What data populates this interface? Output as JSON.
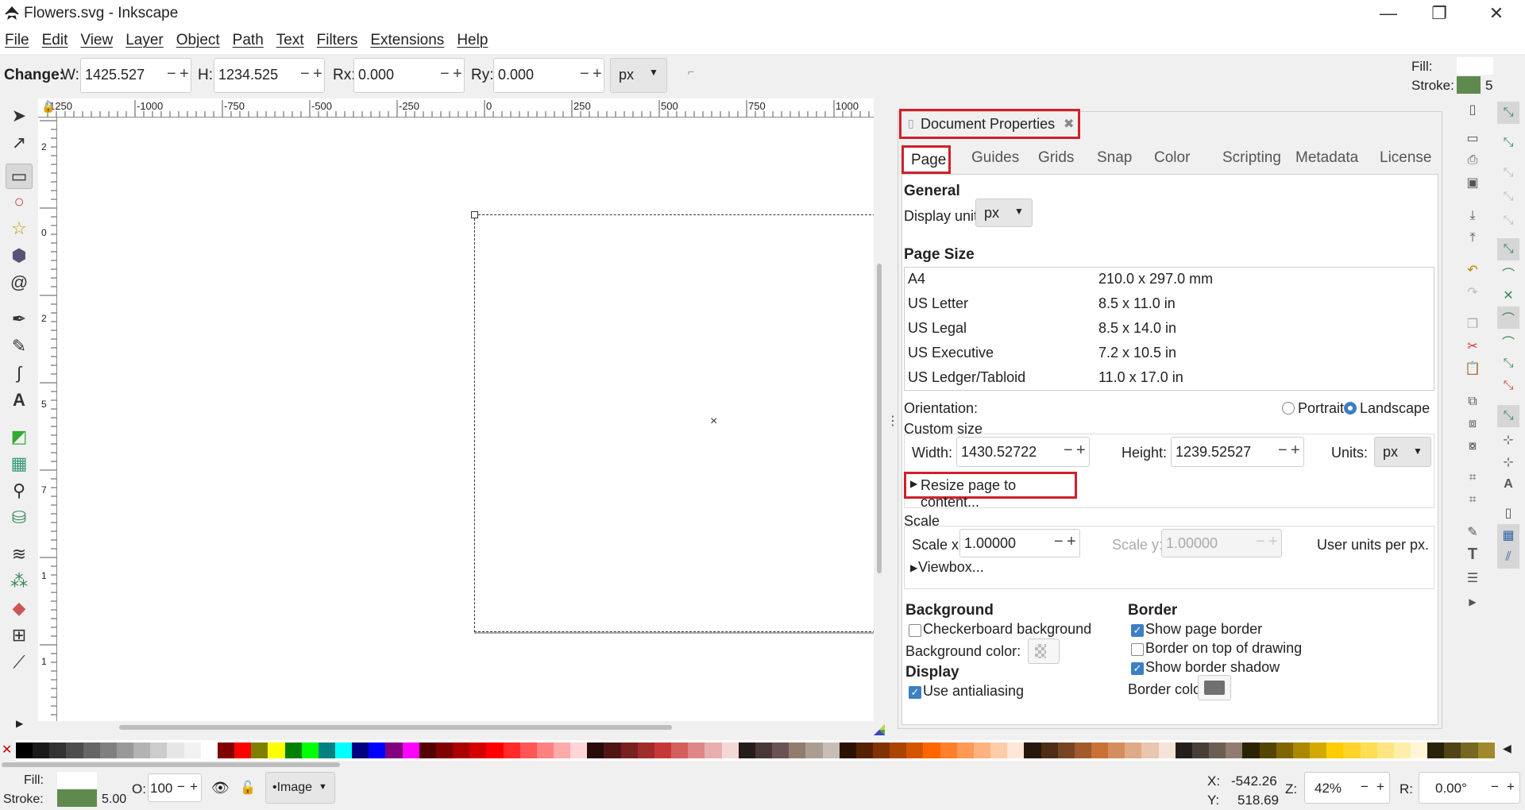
{
  "window": {
    "title": "Flowers.svg - Inkscape",
    "minimize": "—",
    "restore": "❐",
    "close": "✕"
  },
  "menu": [
    "File",
    "Edit",
    "View",
    "Layer",
    "Object",
    "Path",
    "Text",
    "Filters",
    "Extensions",
    "Help"
  ],
  "toolcontrols": {
    "change_label": "Change:",
    "w_label": "W:",
    "w_value": "1425.527",
    "h_label": "H:",
    "h_value": "1234.525",
    "rx_label": "Rx:",
    "rx_value": "0.000",
    "ry_label": "Ry:",
    "ry_value": "0.000",
    "unit": "px",
    "fill_label": "Fill:",
    "stroke_label": "Stroke:",
    "stroke_width": "5",
    "stroke_color": "#5e8a4e"
  },
  "ruler": {
    "h_ticks": [
      "1250",
      "-1000",
      "-750",
      "-500",
      "-250",
      "0",
      "250",
      "500",
      "750",
      "1000"
    ],
    "v_ticks": [
      "2",
      "0",
      "2",
      "5",
      "7",
      "1",
      "1"
    ]
  },
  "dialog": {
    "title": "Document Properties",
    "tabs": [
      "Page",
      "Guides",
      "Grids",
      "Snap",
      "Color",
      "Scripting",
      "Metadata",
      "License"
    ],
    "active_tab": "Page",
    "general_header": "General",
    "display_units_label": "Display units:",
    "display_units_value": "px",
    "page_size_header": "Page Size",
    "page_sizes": [
      {
        "name": "A4",
        "size": "210.0 x 297.0 mm"
      },
      {
        "name": "US Letter",
        "size": "8.5 x 11.0 in"
      },
      {
        "name": "US Legal",
        "size": "8.5 x 14.0 in"
      },
      {
        "name": "US Executive",
        "size": "7.2 x 10.5 in"
      },
      {
        "name": "US Ledger/Tabloid",
        "size": "11.0 x 17.0 in"
      }
    ],
    "orientation_label": "Orientation:",
    "portrait_label": "Portrait",
    "landscape_label": "Landscape",
    "custom_size_label": "Custom size",
    "width_label": "Width:",
    "width_value": "1430.52722",
    "height_label": "Height:",
    "height_value": "1239.52527",
    "units_label": "Units:",
    "units_value": "px",
    "resize_label": "Resize page to content...",
    "scale_label": "Scale",
    "scale_x_label": "Scale x:",
    "scale_x_value": "1.00000",
    "scale_y_label": "Scale y:",
    "scale_y_value": "1.00000",
    "user_units_label": "User units per px.",
    "viewbox_label": "Viewbox...",
    "background_header": "Background",
    "checkerboard_label": "Checkerboard background",
    "background_color_label": "Background color:",
    "display_header": "Display",
    "antialias_label": "Use antialiasing",
    "border_header": "Border",
    "show_page_border_label": "Show page border",
    "border_on_top_label": "Border on top of drawing",
    "show_border_shadow_label": "Show border shadow",
    "border_color_label": "Border color:",
    "border_color_value": "#707070"
  },
  "status": {
    "fill_label": "Fill:",
    "stroke_label": "Stroke:",
    "stroke_width": "5.00",
    "opacity_label": "O:",
    "opacity_value": "100",
    "layer_value": "•Image",
    "x_label": "X:",
    "x_value": "-542.26",
    "y_label": "Y:",
    "y_value": "518.69",
    "zoom_label": "Z:",
    "zoom_value": "42%",
    "rot_label": "R:",
    "rot_value": "0.00°"
  },
  "palette": [
    "#000000",
    "#1a1a1a",
    "#333333",
    "#4d4d4d",
    "#666666",
    "#808080",
    "#999999",
    "#b3b3b3",
    "#cccccc",
    "#e6e6e6",
    "#f2f2f2",
    "#ffffff",
    "#800000",
    "#ff0000",
    "#808000",
    "#ffff00",
    "#008000",
    "#00ff00",
    "#008080",
    "#00ffff",
    "#000080",
    "#0000ff",
    "#800080",
    "#ff00ff",
    "#550000",
    "#800000",
    "#aa0000",
    "#d40000",
    "#ff0000",
    "#ff2a2a",
    "#ff5555",
    "#ff8080",
    "#ffaaaa",
    "#ffd5d5",
    "#280b0b",
    "#501616",
    "#782121",
    "#a02c2c",
    "#c83737",
    "#d35f5f",
    "#de8787",
    "#e9afaf",
    "#f4d7d7",
    "#241c1c",
    "#483737",
    "#6c5353",
    "#917c6f",
    "#ac9d93",
    "#c8beb7",
    "#2b1100",
    "#552200",
    "#803300",
    "#aa4400",
    "#d45500",
    "#ff6600",
    "#ff7f2a",
    "#ff9955",
    "#ffb380",
    "#ffccaa",
    "#ffe6d5",
    "#28170b",
    "#502d16",
    "#784421",
    "#a05a2c",
    "#c87137",
    "#d38d5f",
    "#deaa87",
    "#e9c6af",
    "#f4e3d7",
    "#241f1c",
    "#483e37",
    "#6c5d53",
    "#917c6f",
    "#2b2200",
    "#554400",
    "#806600",
    "#aa8800",
    "#d4aa00",
    "#ffcc00",
    "#ffd42a",
    "#ffdd55",
    "#ffe680",
    "#ffeeaa",
    "#fff6d5",
    "#28220b",
    "#504416",
    "#786721",
    "#a0892c"
  ]
}
